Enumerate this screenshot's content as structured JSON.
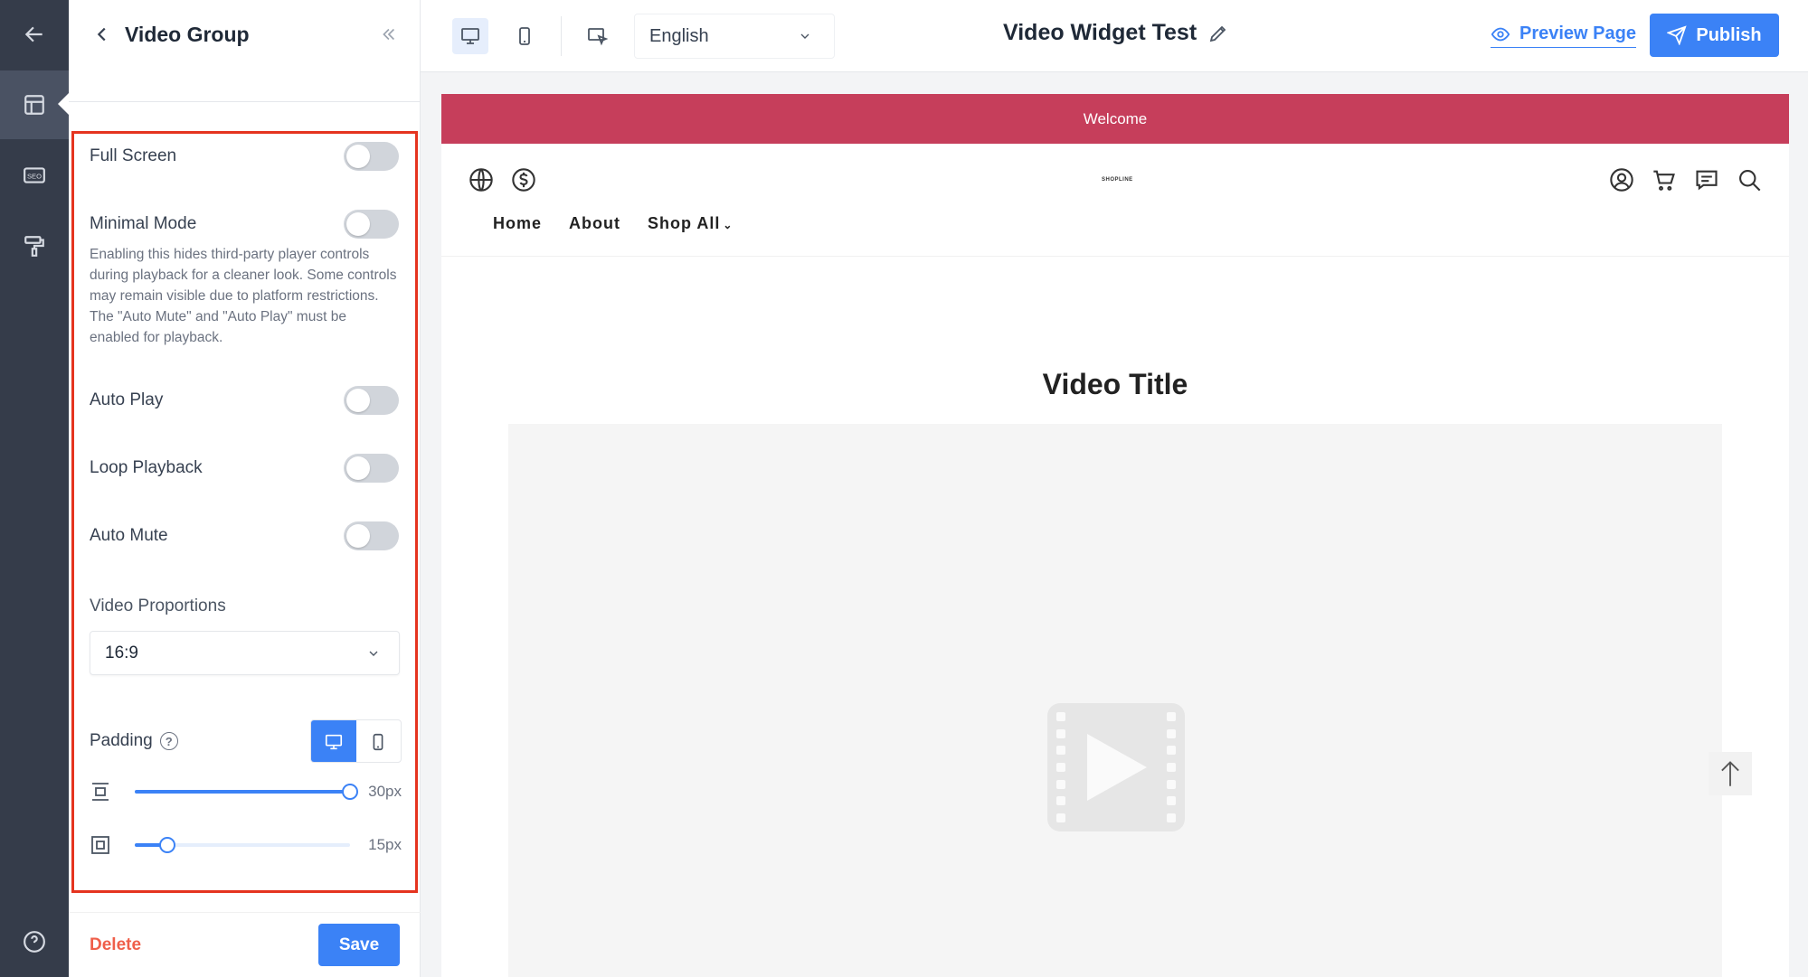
{
  "rail": {
    "items": [
      {
        "icon": "back-arrow-icon"
      },
      {
        "icon": "layout-icon"
      },
      {
        "icon": "seo-icon",
        "label": "SEO"
      },
      {
        "icon": "paint-roller-icon"
      },
      {
        "icon": "help-circle-icon"
      }
    ]
  },
  "panel": {
    "title": "Video Group",
    "toggles": [
      {
        "label": "Full Screen",
        "on": false
      },
      {
        "label": "Minimal Mode",
        "on": false
      },
      {
        "label": "Auto Play",
        "on": false
      },
      {
        "label": "Loop Playback",
        "on": false
      },
      {
        "label": "Auto Mute",
        "on": false
      }
    ],
    "minimal_help": "Enabling this hides third-party player controls during playback for a cleaner look. Some controls may remain visible due to platform restrictions. The \"Auto Mute\" and \"Auto Play\" must be enabled for playback.",
    "proportions_label": "Video Proportions",
    "proportions_value": "16:9",
    "padding_label": "Padding",
    "padding_help_icon": "?",
    "padding_device_selected": "desktop",
    "sliders": [
      {
        "icon": "vertical-padding-icon",
        "value_label": "30px",
        "value": 30,
        "max": 30
      },
      {
        "icon": "horizontal-padding-icon",
        "value_label": "15px",
        "value": 15,
        "max": 100
      }
    ],
    "delete_label": "Delete",
    "save_label": "Save"
  },
  "topbar": {
    "language": "English",
    "doc_title": "Video Widget Test",
    "preview_label": "Preview Page",
    "publish_label": "Publish"
  },
  "store": {
    "banner": "Welcome",
    "logo": "SHOPLINE",
    "nav": [
      "Home",
      "About",
      "Shop All"
    ],
    "video_title": "Video Title"
  },
  "colors": {
    "accent": "#3b82f6",
    "banner": "#c63e5b",
    "highlight": "#e5341f",
    "delete": "#ef5f4a"
  }
}
